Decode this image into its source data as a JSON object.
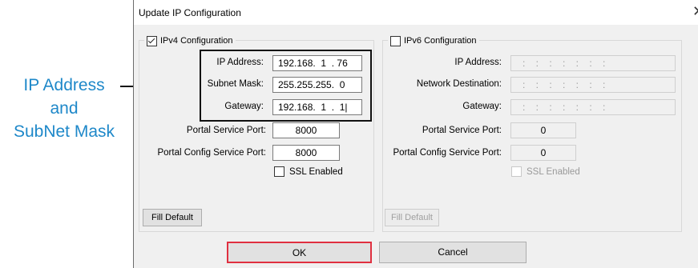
{
  "annotation": {
    "lines": [
      "IP Address",
      "and",
      "SubNet Mask"
    ],
    "color": "#1e88c9"
  },
  "dialog": {
    "title": "Update IP Configuration",
    "close_icon": "close-icon",
    "ipv4": {
      "legend": "IPv4 Configuration",
      "enabled": true,
      "ip_address_label": "IP Address:",
      "ip_address_value": "192.168.  1  . 76",
      "subnet_label": "Subnet Mask:",
      "subnet_value": "255.255.255.  0",
      "gateway_label": "Gateway:",
      "gateway_value": "192.168.  1  .  1|",
      "portal_service_port_label": "Portal Service Port:",
      "portal_service_port_value": "8000",
      "portal_config_port_label": "Portal Config Service Port:",
      "portal_config_port_value": "8000",
      "ssl_label": "SSL Enabled",
      "ssl_checked": false,
      "fill_default_label": "Fill Default"
    },
    "ipv6": {
      "legend": "IPv6 Configuration",
      "enabled": false,
      "ip_address_label": "IP Address:",
      "ip_address_value": ":    :    :    :    :    :    :",
      "network_destination_label": "Network Destination:",
      "network_destination_value": ":    :    :    :    :    :    :",
      "gateway_label": "Gateway:",
      "gateway_value": ":    :    :    :    :    :    :",
      "portal_service_port_label": "Portal Service Port:",
      "portal_service_port_value": "0",
      "portal_config_port_label": "Portal Config Service Port:",
      "portal_config_port_value": "0",
      "ssl_label": "SSL Enabled",
      "ssl_checked": false,
      "fill_default_label": "Fill Default"
    },
    "ok_label": "OK",
    "cancel_label": "Cancel",
    "ok_highlight_color": "#e03040"
  }
}
